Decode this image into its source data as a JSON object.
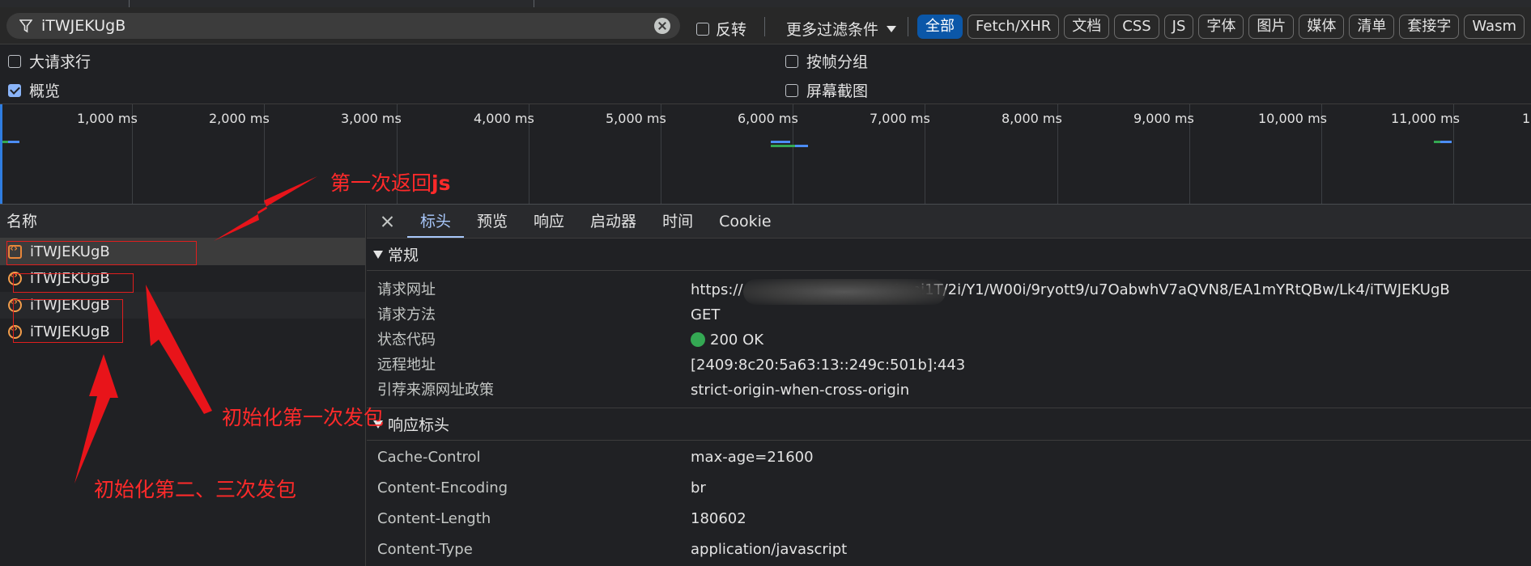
{
  "filter_bar": {
    "search_value": "iTWJEKUgB",
    "invert_label": "反转",
    "more_filters_label": "更多过滤条件",
    "type_chips": [
      "全部",
      "Fetch/XHR",
      "文档",
      "CSS",
      "JS",
      "字体",
      "图片",
      "媒体",
      "清单",
      "套接字",
      "Wasm"
    ]
  },
  "options": {
    "large_rows_label": "大请求行",
    "overview_label": "概览",
    "group_by_frame_label": "按帧分组",
    "screenshots_label": "屏幕截图"
  },
  "timeline": {
    "ticks": [
      "1,000 ms",
      "2,000 ms",
      "3,000 ms",
      "4,000 ms",
      "5,000 ms",
      "6,000 ms",
      "7,000 ms",
      "8,000 ms",
      "9,000 ms",
      "10,000 ms",
      "11,000 ms",
      "1"
    ]
  },
  "request_list": {
    "header": "名称",
    "rows": [
      {
        "name": "iTWJEKUgB"
      },
      {
        "name": "iTWJEKUgB"
      },
      {
        "name": "iTWJEKUgB"
      },
      {
        "name": "iTWJEKUgB"
      }
    ]
  },
  "details": {
    "tabs": [
      "标头",
      "预览",
      "响应",
      "启动器",
      "时间",
      "Cookie"
    ],
    "general_title": "常规",
    "general": [
      {
        "key": "请求网址",
        "value": "https://"
      },
      {
        "key": "请求方法",
        "value": "GET"
      },
      {
        "key": "状态代码",
        "value": "200 OK"
      },
      {
        "key": "远程地址",
        "value": "[2409:8c20:5a63:13::249c:501b]:443"
      },
      {
        "key": "引荐来源网址政策",
        "value": "strict-origin-when-cross-origin"
      }
    ],
    "url_tail": "/ami1T/2i/Y1/W00i/9ryott9/u7OabwhV7aQVN8/EA1mYRtQBw/Lk4/iTWJEKUgB",
    "response_headers_title": "响应标头",
    "response_headers": [
      {
        "key": "Cache-Control",
        "value": "max-age=21600"
      },
      {
        "key": "Content-Encoding",
        "value": "br"
      },
      {
        "key": "Content-Length",
        "value": "180602"
      },
      {
        "key": "Content-Type",
        "value": "application/javascript"
      }
    ]
  },
  "annotations": {
    "first_return": "第一次返回",
    "first_return_bold": "js",
    "init_first": "初始化第一次发包",
    "init_second_third": "初始化第二、三次发包"
  },
  "colors": {
    "background": "#202124",
    "accent_blue": "#0b57a8",
    "annotation_red": "#ff2a2a",
    "status_green": "#34a853"
  }
}
